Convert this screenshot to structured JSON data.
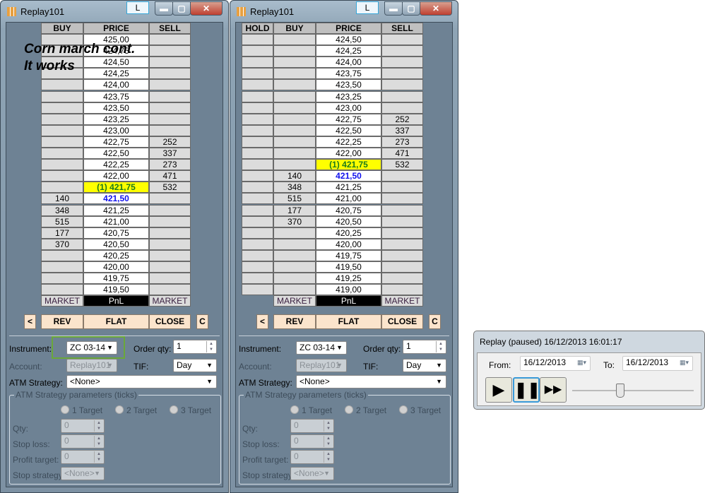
{
  "annotation": {
    "line1": "Corn march cont.",
    "line2": "It works"
  },
  "windows": [
    {
      "title": "Replay101",
      "l_button": "L",
      "has_hold": false,
      "headers": {
        "hold": "HOLD",
        "buy": "BUY",
        "price": "PRICE",
        "sell": "SELL"
      },
      "rows": [
        {
          "buy": "",
          "price": "425,00",
          "sell": ""
        },
        {
          "buy": "",
          "price": "424,75",
          "sell": ""
        },
        {
          "buy": "",
          "price": "424,50",
          "sell": ""
        },
        {
          "buy": "",
          "price": "424,25",
          "sell": ""
        },
        {
          "buy": "",
          "price": "424,00",
          "sell": ""
        },
        {
          "buy": "",
          "price": "423,75",
          "sell": ""
        },
        {
          "buy": "",
          "price": "423,50",
          "sell": ""
        },
        {
          "buy": "",
          "price": "423,25",
          "sell": ""
        },
        {
          "buy": "",
          "price": "423,00",
          "sell": ""
        },
        {
          "buy": "",
          "price": "422,75",
          "sell": "252"
        },
        {
          "buy": "",
          "price": "422,50",
          "sell": "337"
        },
        {
          "buy": "",
          "price": "422,25",
          "sell": "273"
        },
        {
          "buy": "",
          "price": "422,00",
          "sell": "471"
        },
        {
          "buy": "",
          "price": "(1) 421,75",
          "sell": "532",
          "position": true
        },
        {
          "buy": "140",
          "price": "421,50",
          "sell": "",
          "last": true
        },
        {
          "buy": "348",
          "price": "421,25",
          "sell": ""
        },
        {
          "buy": "515",
          "price": "421,00",
          "sell": ""
        },
        {
          "buy": "177",
          "price": "420,75",
          "sell": ""
        },
        {
          "buy": "370",
          "price": "420,50",
          "sell": ""
        },
        {
          "buy": "",
          "price": "420,25",
          "sell": ""
        },
        {
          "buy": "",
          "price": "420,00",
          "sell": ""
        },
        {
          "buy": "",
          "price": "419,75",
          "sell": ""
        },
        {
          "buy": "",
          "price": "419,50",
          "sell": ""
        }
      ],
      "footer": {
        "buy": "MARKET",
        "price": "PnL",
        "sell": "MARKET"
      },
      "buttons": {
        "left": "<",
        "rev": "REV",
        "flat": "FLAT",
        "close": "CLOSE",
        "c": "C"
      },
      "form": {
        "instrument_label": "Instrument:",
        "instrument": "ZC 03-14",
        "order_qty_label": "Order qty:",
        "order_qty": "1",
        "account_label": "Account:",
        "account": "Replay101",
        "tif_label": "TIF:",
        "tif": "Day",
        "atm_label": "ATM Strategy:",
        "atm": "<None>",
        "group_title": "ATM Strategy parameters (ticks)",
        "targets": [
          "1 Target",
          "2 Target",
          "3 Target"
        ],
        "selected_target": "1 Target",
        "qty_label": "Qty:",
        "qty": "0",
        "stop_loss_label": "Stop loss:",
        "stop_loss": "0",
        "profit_target_label": "Profit target:",
        "profit_target": "0",
        "stop_strategy_label": "Stop strategy:",
        "stop_strategy": "<None>"
      }
    },
    {
      "title": "Replay101",
      "l_button": "L",
      "has_hold": true,
      "headers": {
        "hold": "HOLD",
        "buy": "BUY",
        "price": "PRICE",
        "sell": "SELL"
      },
      "rows": [
        {
          "buy": "",
          "price": "424,50",
          "sell": ""
        },
        {
          "buy": "",
          "price": "424,25",
          "sell": ""
        },
        {
          "buy": "",
          "price": "424,00",
          "sell": ""
        },
        {
          "buy": "",
          "price": "423,75",
          "sell": ""
        },
        {
          "buy": "",
          "price": "423,50",
          "sell": ""
        },
        {
          "buy": "",
          "price": "423,25",
          "sell": ""
        },
        {
          "buy": "",
          "price": "423,00",
          "sell": ""
        },
        {
          "buy": "",
          "price": "422,75",
          "sell": "252"
        },
        {
          "buy": "",
          "price": "422,50",
          "sell": "337"
        },
        {
          "buy": "",
          "price": "422,25",
          "sell": "273"
        },
        {
          "buy": "",
          "price": "422,00",
          "sell": "471"
        },
        {
          "buy": "",
          "price": "(1) 421,75",
          "sell": "532",
          "position": true
        },
        {
          "buy": "140",
          "price": "421,50",
          "sell": "",
          "last": true
        },
        {
          "buy": "348",
          "price": "421,25",
          "sell": ""
        },
        {
          "buy": "515",
          "price": "421,00",
          "sell": ""
        },
        {
          "buy": "177",
          "price": "420,75",
          "sell": ""
        },
        {
          "buy": "370",
          "price": "420,50",
          "sell": ""
        },
        {
          "buy": "",
          "price": "420,25",
          "sell": ""
        },
        {
          "buy": "",
          "price": "420,00",
          "sell": ""
        },
        {
          "buy": "",
          "price": "419,75",
          "sell": ""
        },
        {
          "buy": "",
          "price": "419,50",
          "sell": ""
        },
        {
          "buy": "",
          "price": "419,25",
          "sell": ""
        },
        {
          "buy": "",
          "price": "419,00",
          "sell": ""
        }
      ],
      "footer": {
        "buy": "MARKET",
        "price": "PnL",
        "sell": "MARKET"
      },
      "buttons": {
        "left": "<",
        "rev": "REV",
        "flat": "FLAT",
        "close": "CLOSE",
        "c": "C"
      },
      "form": {
        "instrument_label": "Instrument:",
        "instrument": "ZC 03-14",
        "order_qty_label": "Order qty:",
        "order_qty": "1",
        "account_label": "Account:",
        "account": "Replay101",
        "tif_label": "TIF:",
        "tif": "Day",
        "atm_label": "ATM Strategy:",
        "atm": "<None>",
        "group_title": "ATM Strategy parameters (ticks)",
        "targets": [
          "1 Target",
          "2 Target",
          "3 Target"
        ],
        "selected_target": "1 Target",
        "qty_label": "Qty:",
        "qty": "0",
        "stop_loss_label": "Stop loss:",
        "stop_loss": "0",
        "profit_target_label": "Profit target:",
        "profit_target": "0",
        "stop_strategy_label": "Stop strategy:",
        "stop_strategy": "<None>"
      }
    }
  ],
  "replay": {
    "title": "Replay (paused) 16/12/2013 16:01:17",
    "from_label": "From:",
    "from": "16/12/2013",
    "to_label": "To:",
    "to": "16/12/2013",
    "speed_fraction": 0.39,
    "colors": {
      "position": "#ffff00",
      "last_price": "#1010ee",
      "highlight": "#6aa83a"
    }
  }
}
